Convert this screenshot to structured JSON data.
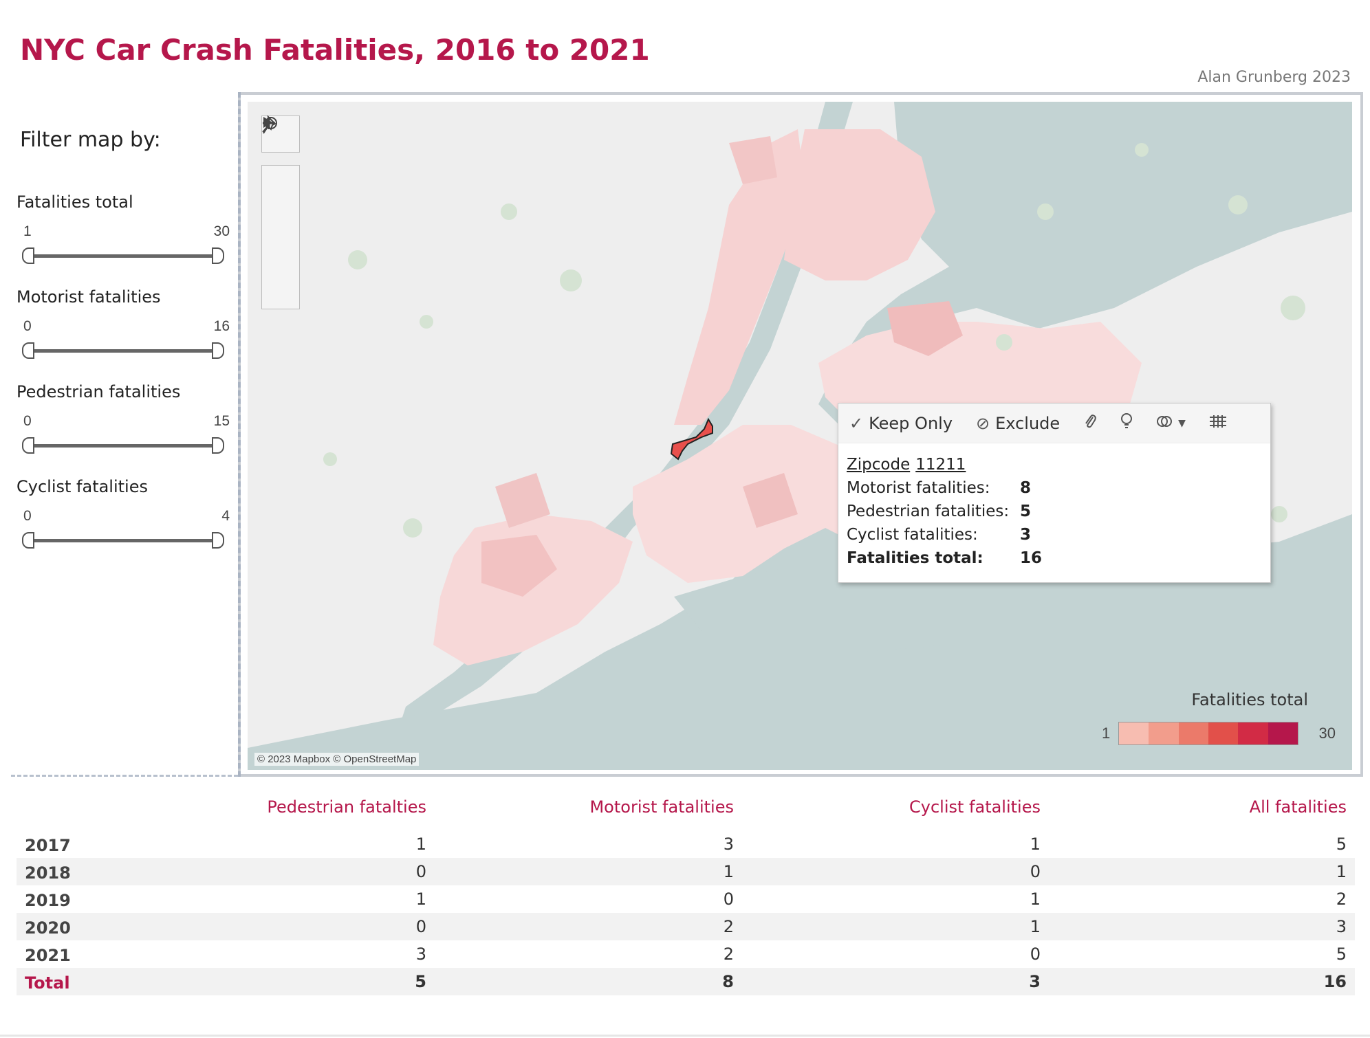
{
  "title": "NYC Car Crash Fatalities, 2016 to 2021",
  "credit": "Alan Grunberg 2023",
  "sidebar": {
    "heading": "Filter map by:",
    "filters": [
      {
        "label": "Fatalities total",
        "min": "1",
        "max": "30"
      },
      {
        "label": "Motorist fatalities",
        "min": "0",
        "max": "16"
      },
      {
        "label": "Pedestrian fatalities",
        "min": "0",
        "max": "15"
      },
      {
        "label": "Cyclist fatalities",
        "min": "0",
        "max": "4"
      }
    ]
  },
  "map": {
    "attribution": "© 2023 Mapbox © OpenStreetMap",
    "controls": {
      "search_icon": "search-icon",
      "zoom_in_icon": "plus-icon",
      "zoom_out_icon": "minus-icon",
      "pin_icon": "pin-icon",
      "expand_icon": "play-icon"
    },
    "legend": {
      "title": "Fatalities total",
      "min": "1",
      "max": "30",
      "colors": [
        "#f7bdb1",
        "#f29d8c",
        "#eb7a6a",
        "#e2504a",
        "#d22b45",
        "#b5174b"
      ]
    },
    "selected_zip_color": "#e8504c"
  },
  "tooltip": {
    "toolbar": {
      "keep_only": "Keep Only",
      "exclude": "Exclude"
    },
    "zip_label": "Zipcode",
    "zip_value": "11211",
    "rows": [
      {
        "key": "Motorist fatalities:",
        "value": "8"
      },
      {
        "key": "Pedestrian fatalities:",
        "value": "5"
      },
      {
        "key": "Cyclist fatalities:",
        "value": "3"
      },
      {
        "key": "Fatalities total:",
        "value": "16"
      }
    ]
  },
  "table": {
    "headers": [
      "Pedestrian fatalties",
      "Motorist fatalities",
      "Cyclist fatalities",
      "All fatalities"
    ],
    "rows": [
      {
        "year": "2017",
        "values": [
          "1",
          "3",
          "1",
          "5"
        ]
      },
      {
        "year": "2018",
        "values": [
          "0",
          "1",
          "0",
          "1"
        ]
      },
      {
        "year": "2019",
        "values": [
          "1",
          "0",
          "1",
          "2"
        ]
      },
      {
        "year": "2020",
        "values": [
          "0",
          "2",
          "1",
          "3"
        ]
      },
      {
        "year": "2021",
        "values": [
          "3",
          "2",
          "0",
          "5"
        ]
      }
    ],
    "total": {
      "label": "Total",
      "values": [
        "5",
        "8",
        "3",
        "16"
      ]
    }
  },
  "colors": {
    "accent": "#b5174b",
    "water": "#c3d3d3",
    "land": "#eeeeee"
  }
}
